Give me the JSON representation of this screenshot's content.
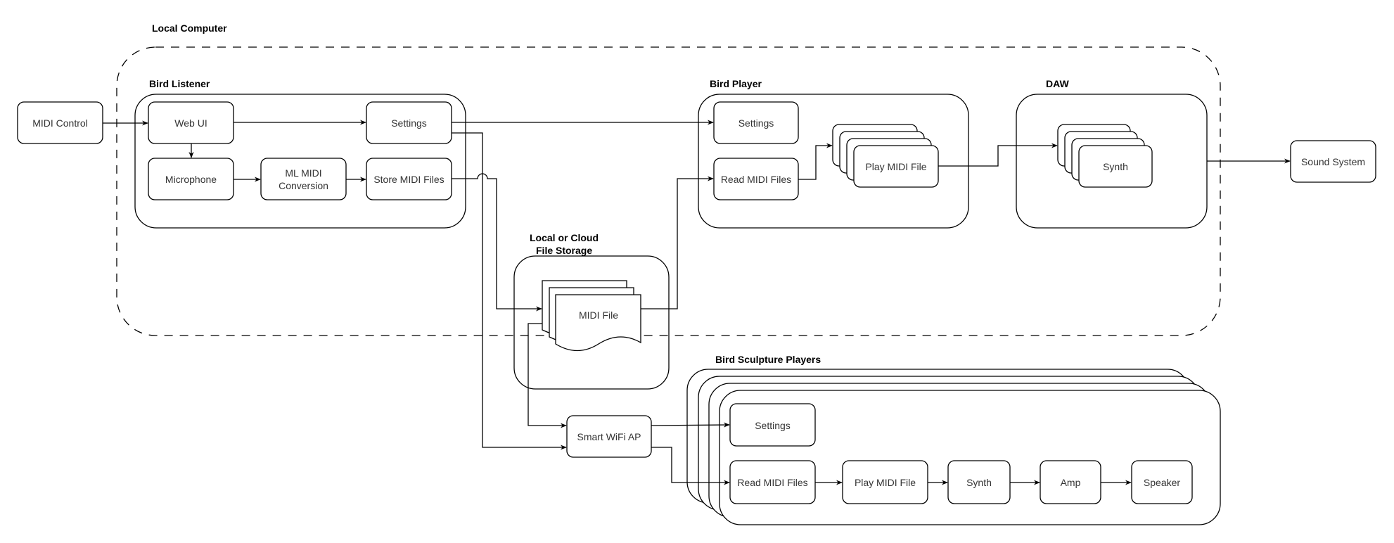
{
  "diagram": {
    "groups": {
      "local_computer": "Local Computer",
      "bird_listener": "Bird Listener",
      "bird_player": "Bird Player",
      "daw": "DAW",
      "file_storage_line1": "Local or Cloud",
      "file_storage_line2": "File Storage",
      "bird_sculpture_players": "Bird Sculpture Players"
    },
    "nodes": {
      "midi_control": "MIDI Control",
      "listener_web_ui": "Web UI",
      "listener_settings": "Settings",
      "listener_microphone": "Microphone",
      "listener_ml_line1": "ML MIDI",
      "listener_ml_line2": "Conversion",
      "listener_store": "Store MIDI Files",
      "player_settings": "Settings",
      "player_read": "Read MIDI Files",
      "player_play": "Play MIDI File",
      "daw_synth": "Synth",
      "sound_system": "Sound System",
      "midi_file": "MIDI File",
      "smart_wifi_ap": "Smart WiFi AP",
      "sculpture_settings": "Settings",
      "sculpture_read": "Read MIDI Files",
      "sculpture_play": "Play MIDI File",
      "sculpture_synth": "Synth",
      "sculpture_amp": "Amp",
      "sculpture_speaker": "Speaker"
    },
    "edges": [
      {
        "from": "MIDI Control",
        "to": "Web UI"
      },
      {
        "from": "Web UI",
        "to": "Settings (Bird Listener)"
      },
      {
        "from": "Web UI",
        "to": "Microphone"
      },
      {
        "from": "Microphone",
        "to": "ML MIDI Conversion"
      },
      {
        "from": "ML MIDI Conversion",
        "to": "Store MIDI Files"
      },
      {
        "from": "Settings (Bird Listener)",
        "to": "Settings (Bird Player)"
      },
      {
        "from": "Settings (Bird Listener)",
        "to": "Smart WiFi AP"
      },
      {
        "from": "Store MIDI Files",
        "to": "MIDI File"
      },
      {
        "from": "MIDI File",
        "to": "Read MIDI Files (Bird Player)"
      },
      {
        "from": "MIDI File",
        "to": "Smart WiFi AP"
      },
      {
        "from": "Read MIDI Files (Bird Player)",
        "to": "Play MIDI File (Bird Player)"
      },
      {
        "from": "Play MIDI File (Bird Player)",
        "to": "Synth (DAW)"
      },
      {
        "from": "DAW",
        "to": "Sound System"
      },
      {
        "from": "Smart WiFi AP",
        "to": "Settings (Bird Sculpture)"
      },
      {
        "from": "Smart WiFi AP",
        "to": "Read MIDI Files (Bird Sculpture)"
      },
      {
        "from": "Read MIDI Files (Bird Sculpture)",
        "to": "Play MIDI File (Bird Sculpture)"
      },
      {
        "from": "Play MIDI File (Bird Sculpture)",
        "to": "Synth (Bird Sculpture)"
      },
      {
        "from": "Synth (Bird Sculpture)",
        "to": "Amp"
      },
      {
        "from": "Amp",
        "to": "Speaker"
      }
    ]
  }
}
